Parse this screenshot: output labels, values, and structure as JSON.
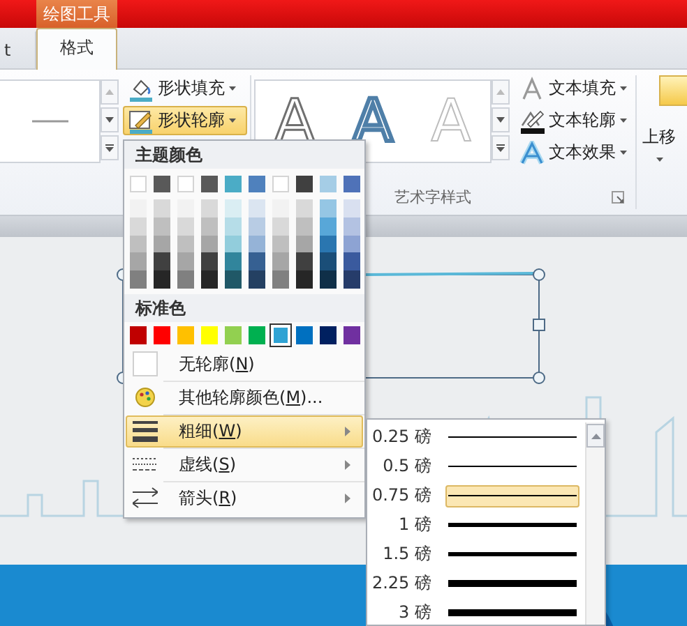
{
  "context_tab": {
    "label": "绘图工具"
  },
  "tabs": [
    {
      "label": "t",
      "selected": false
    },
    {
      "label": "格式",
      "selected": true
    }
  ],
  "ribbon": {
    "shape_commands": [
      {
        "label": "形状填充",
        "kind": "fill",
        "selected": false
      },
      {
        "label": "形状轮廓",
        "kind": "outline",
        "selected": true
      }
    ],
    "wordart_styles": [
      {
        "label": "A",
        "kind": "outline"
      },
      {
        "label": "A",
        "kind": "blue"
      },
      {
        "label": "A",
        "kind": "light"
      }
    ],
    "text_commands": [
      {
        "label": "文本填充",
        "kind": "fill"
      },
      {
        "label": "文本轮廓",
        "kind": "outline"
      },
      {
        "label": "文本效果",
        "kind": "effect"
      }
    ],
    "group_label": "艺术字样式",
    "arrange_label": "上移"
  },
  "outline_menu": {
    "theme_heading": "主题颜色",
    "theme_colors": [
      [
        {
          "color": "#ffffff"
        },
        {
          "color": "#595959"
        },
        {
          "color": "#ffffff"
        },
        {
          "color": "#595959"
        },
        {
          "color": "#4bacc6"
        },
        {
          "color": "#4f81bd"
        },
        {
          "color": "#ffffff"
        },
        {
          "color": "#404040"
        },
        {
          "color": "#a5cde6"
        },
        {
          "color": "#4f72b8"
        }
      ],
      [
        {
          "color": "#f2f2f2"
        },
        {
          "color": "#d9d9d9"
        },
        {
          "color": "#f2f2f2"
        },
        {
          "color": "#d9d9d9"
        },
        {
          "color": "#daeef3"
        },
        {
          "color": "#dbe5f1"
        },
        {
          "color": "#f2f2f2"
        },
        {
          "color": "#d9d9d9"
        },
        {
          "color": "#95c6e4"
        },
        {
          "color": "#d9e0f0"
        }
      ],
      [
        {
          "color": "#d9d9d9"
        },
        {
          "color": "#bfbfbf"
        },
        {
          "color": "#d9d9d9"
        },
        {
          "color": "#bfbfbf"
        },
        {
          "color": "#b6dde8"
        },
        {
          "color": "#b8cce4"
        },
        {
          "color": "#d9d9d9"
        },
        {
          "color": "#bfbfbf"
        },
        {
          "color": "#58a7d8"
        },
        {
          "color": "#b3c2e2"
        }
      ],
      [
        {
          "color": "#bfbfbf"
        },
        {
          "color": "#a6a6a6"
        },
        {
          "color": "#bfbfbf"
        },
        {
          "color": "#a6a6a6"
        },
        {
          "color": "#92cddc"
        },
        {
          "color": "#95b3d7"
        },
        {
          "color": "#bfbfbf"
        },
        {
          "color": "#a6a6a6"
        },
        {
          "color": "#2a76b0"
        },
        {
          "color": "#8da3d3"
        }
      ],
      [
        {
          "color": "#a6a6a6"
        },
        {
          "color": "#404040"
        },
        {
          "color": "#a6a6a6"
        },
        {
          "color": "#404040"
        },
        {
          "color": "#31859c"
        },
        {
          "color": "#366092"
        },
        {
          "color": "#a6a6a6"
        },
        {
          "color": "#404040"
        },
        {
          "color": "#1a4e78"
        },
        {
          "color": "#3a5a9e"
        }
      ],
      [
        {
          "color": "#808080"
        },
        {
          "color": "#262626"
        },
        {
          "color": "#808080"
        },
        {
          "color": "#262626"
        },
        {
          "color": "#205867"
        },
        {
          "color": "#244062"
        },
        {
          "color": "#808080"
        },
        {
          "color": "#262626"
        },
        {
          "color": "#0f2f48"
        },
        {
          "color": "#263c6a"
        }
      ]
    ],
    "standard_heading": "标准色",
    "standard_colors": [
      {
        "color": "#c00000",
        "selected": false
      },
      {
        "color": "#ff0000",
        "selected": false
      },
      {
        "color": "#ffc000",
        "selected": false
      },
      {
        "color": "#ffff00",
        "selected": false
      },
      {
        "color": "#92d050",
        "selected": false
      },
      {
        "color": "#00b050",
        "selected": false
      },
      {
        "color": "#2fa3d4",
        "selected": true
      },
      {
        "color": "#0070c0",
        "selected": false
      },
      {
        "color": "#002060",
        "selected": false
      },
      {
        "color": "#7030a0",
        "selected": false
      }
    ],
    "items": [
      {
        "kind": "no-outline",
        "before": "无轮廓(",
        "key": "N",
        "after": ")",
        "submenu": false,
        "selected": false
      },
      {
        "kind": "more-colors",
        "before": "其他轮廓颜色(",
        "key": "M",
        "after": ")...",
        "submenu": false,
        "selected": false
      },
      {
        "kind": "weight",
        "before": "粗细(",
        "key": "W",
        "after": ")",
        "submenu": true,
        "selected": true
      },
      {
        "kind": "dash",
        "before": "虚线(",
        "key": "S",
        "after": ")",
        "submenu": true,
        "selected": false
      },
      {
        "kind": "arrows",
        "before": "箭头(",
        "key": "R",
        "after": ")",
        "submenu": true,
        "selected": false
      }
    ]
  },
  "weight_menu": {
    "items": [
      {
        "label": "0.25 磅",
        "selected": false
      },
      {
        "label": "0.5 磅",
        "selected": false
      },
      {
        "label": "0.75 磅",
        "selected": true
      },
      {
        "label": "1 磅",
        "selected": false
      },
      {
        "label": "1.5 磅",
        "selected": false
      },
      {
        "label": "2.25 磅",
        "selected": false
      },
      {
        "label": "3 磅",
        "selected": false
      }
    ]
  }
}
